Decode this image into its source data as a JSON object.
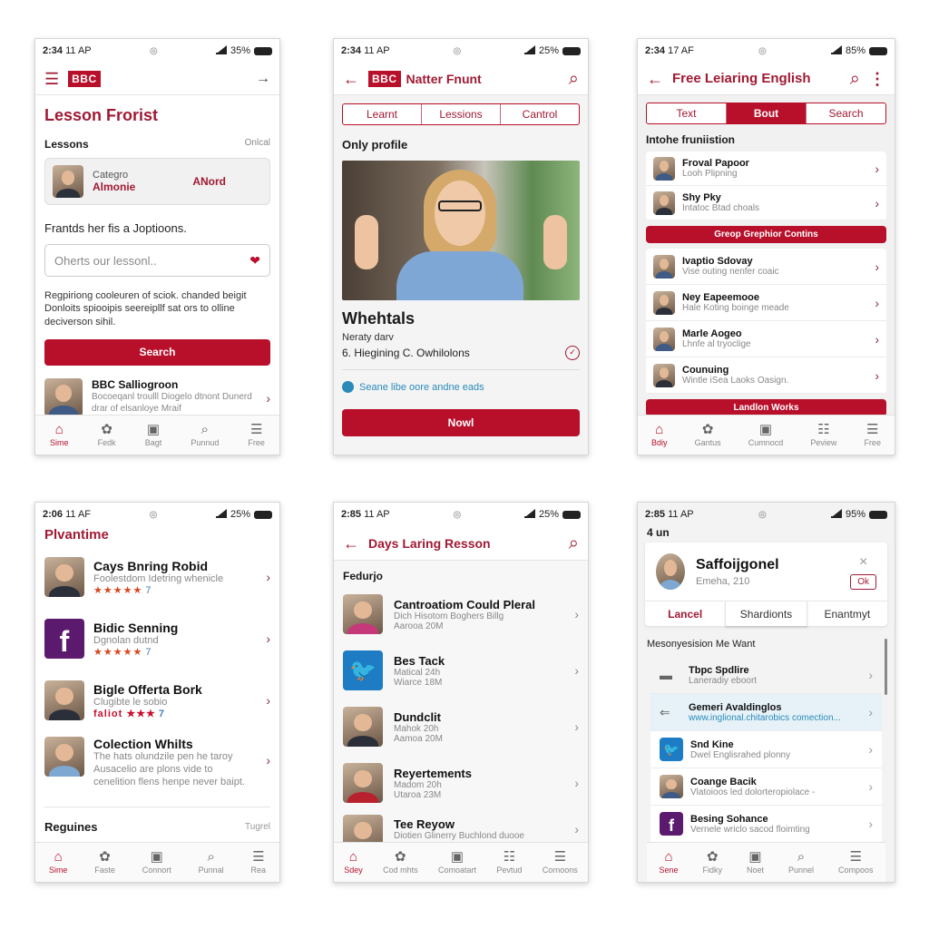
{
  "colors": {
    "brand": "#b8102b",
    "brand_text": "#a01a34",
    "facebook": "#5b1a6e",
    "twitter": "#1d7cc4",
    "link": "#2a8ab8",
    "stars": "#d6471e"
  },
  "screens": [
    {
      "status": {
        "time": "2:34",
        "carrier": "11 AP",
        "battery": "35%"
      },
      "appbar": {
        "logo": "BBC",
        "menu_icon": "☰",
        "action_icon": "→"
      },
      "page_title": "Lesson Frorist",
      "section": {
        "label": "Lessons",
        "action": "Onlcal"
      },
      "card": {
        "category": "Categro",
        "name": "Almonie",
        "action": "ANord"
      },
      "prompt": "Frantds her fis a Joptioons.",
      "dropdown": {
        "placeholder": "Oherts our lessonl.."
      },
      "description": "Regpiriong cooleuren of sciok. chanded beigit Donloits spiooipis seereipllf sat ors to olline deciverson sihil.",
      "search_button": "Search",
      "featured": {
        "title": "BBC Salliogroon",
        "text": "Bocoeqanl troulll Diogelo dtnont Dunerd drar of elsanloye Mraif"
      },
      "nav": [
        {
          "label": "Sime",
          "icon": "⌂",
          "active": true
        },
        {
          "label": "Fedk",
          "icon": "✿",
          "active": false
        },
        {
          "label": "Bagt",
          "icon": "▣",
          "active": false
        },
        {
          "label": "Punnud",
          "icon": "⌕",
          "active": false
        },
        {
          "label": "Free",
          "icon": "☰",
          "active": false
        }
      ]
    },
    {
      "status": {
        "time": "2:34",
        "carrier": "11 AP",
        "battery": "25%"
      },
      "appbar": {
        "logo": "BBC",
        "title": "Natter Fnunt",
        "back_icon": "←",
        "search_icon": "⌕"
      },
      "tabs": [
        "Learnt",
        "Lessions",
        "Cantrol"
      ],
      "section_title": "Only profile",
      "profile": {
        "name": "Whehtals",
        "line1": "Neraty darv",
        "line2": "6. Hiegining C. Owhilolons"
      },
      "link_text": "Seane libe oore andne eads",
      "button": "Nowl"
    },
    {
      "status": {
        "time": "2:34",
        "carrier": "17 AF",
        "battery": "85%"
      },
      "appbar": {
        "title": "Free Leiaring English",
        "back_icon": "←",
        "search_icon": "⌕",
        "more_icon": "⋮"
      },
      "tabs": [
        {
          "label": "Text",
          "active": false
        },
        {
          "label": "Bout",
          "active": true
        },
        {
          "label": "Search",
          "active": false
        }
      ],
      "section_title": "Intohe fruniistion",
      "list_a": [
        {
          "title": "Froval Papoor",
          "sub": "Looh Plipning"
        },
        {
          "title": "Shy Pky",
          "sub": "Intatoc Btad choals"
        }
      ],
      "group_button": "Greop Grephior Contins",
      "list_b": [
        {
          "title": "Ivaptio Sdovay",
          "sub": "Vise outing nenfer coaic"
        },
        {
          "title": "Ney Eapeemooe",
          "sub": "Hale Koting boinge meade"
        },
        {
          "title": "Marle Aogeo",
          "sub": "Lhnfe al tryoclige"
        },
        {
          "title": "Counuing",
          "sub": "Wintle iSea Laoks Oasign."
        }
      ],
      "bottom_button": "Landlon Works",
      "nav": [
        {
          "label": "Bdiy",
          "icon": "⌂",
          "active": true
        },
        {
          "label": "Gantus",
          "icon": "✿",
          "active": false
        },
        {
          "label": "Cumnocd",
          "icon": "▣",
          "active": false
        },
        {
          "label": "Peview",
          "icon": "☷",
          "active": false
        },
        {
          "label": "Free",
          "icon": "☰",
          "active": false
        }
      ]
    },
    {
      "status": {
        "time": "2:06",
        "carrier": "11 AF",
        "battery": "25%"
      },
      "page_title": "Plvantime",
      "items": [
        {
          "title": "Cays Bnring Robid",
          "sub": "Foolestdom Idetring whenicle",
          "stars": "★★★★★",
          "count": "7",
          "thumb": "photo"
        },
        {
          "title": "Bidic Senning",
          "sub": "Dgnolan dutnd",
          "stars": "★★★★★",
          "count": "7",
          "thumb": "facebook"
        },
        {
          "title": "Bigle Offerta Bork",
          "sub": "Clugibte le sobio",
          "stars": "faliot ★★★",
          "count": "7",
          "thumb": "photo"
        },
        {
          "title": "Colection Whilts",
          "sub": "The hats olundzile pen he taroy Ausacelio are plons vide to cenelition flens henpe never baipt.",
          "thumb": "photo"
        }
      ],
      "section": {
        "label": "Reguines",
        "action": "Tugrel"
      },
      "nav": [
        {
          "label": "Sime",
          "icon": "⌂",
          "active": true
        },
        {
          "label": "Faste",
          "icon": "✿",
          "active": false
        },
        {
          "label": "Connort",
          "icon": "▣",
          "active": false
        },
        {
          "label": "Punnal",
          "icon": "⌕",
          "active": false
        },
        {
          "label": "Rea",
          "icon": "☰",
          "active": false
        }
      ]
    },
    {
      "status": {
        "time": "2:85",
        "carrier": "11 AP",
        "battery": "25%"
      },
      "appbar": {
        "title": "Days Laring Resson",
        "back_icon": "←",
        "search_icon": "⌕"
      },
      "section_title": "Fedurjo",
      "items": [
        {
          "title": "Cantroatiom Could Pleral",
          "line1": "Dich Hisotom Boghers Billg",
          "line2": "Aarooa 20M",
          "thumb": "photo"
        },
        {
          "title": "Bes Tack",
          "line1": "Matical 24h",
          "line2": "Wiarce 18M",
          "thumb": "twitter"
        },
        {
          "title": "Dundclit",
          "line1": "Mahok 20h",
          "line2": "Aamoa 20M",
          "thumb": "photo"
        },
        {
          "title": "Reyertements",
          "line1": "Madom 20h",
          "line2": "Utaroa 23M",
          "thumb": "photo"
        },
        {
          "title": "Tee Reyow",
          "line1": "Diotien Glinerry Buchlond duooe",
          "line2": "",
          "thumb": "photo"
        }
      ],
      "nav": [
        {
          "label": "Sdey",
          "icon": "⌂",
          "active": true
        },
        {
          "label": "Cod mhts",
          "icon": "✿",
          "active": false
        },
        {
          "label": "Comoatart",
          "icon": "▣",
          "active": false
        },
        {
          "label": "Pevtud",
          "icon": "☷",
          "active": false
        },
        {
          "label": "Cornoons",
          "icon": "☰",
          "active": false
        }
      ]
    },
    {
      "status": {
        "time": "2:85",
        "carrier": "11 AP",
        "battery": "95%"
      },
      "header_label": "4 un",
      "profile": {
        "name": "Saffoijgonel",
        "sub": "Emeha, 210",
        "ok_button": "Ok",
        "close_icon": "×"
      },
      "tabs": [
        {
          "label": "Lancel",
          "active": true
        },
        {
          "label": "Shardionts",
          "active": false
        },
        {
          "label": "Enantmyt",
          "active": false
        }
      ],
      "section_title": "Mesonyesision Me Want",
      "items": [
        {
          "title": "Tbpc Spdlire",
          "sub": "Laneradiy eboort",
          "thumb": "folder",
          "highlight": false
        },
        {
          "title": "Gemeri Avaldinglos",
          "sub": "www.inglional.chitarobics comection...",
          "thumb": "back",
          "highlight": true
        },
        {
          "title": "Snd Kine",
          "sub": "Dwel Englisrahed plonny",
          "thumb": "twitter",
          "highlight": false
        },
        {
          "title": "Coange Bacik",
          "sub": "Vlatoioos led dolorteropiolace -",
          "thumb": "photo",
          "highlight": false
        },
        {
          "title": "Besing Sohance",
          "sub": "Vernele wriclo sacod floimting",
          "thumb": "facebook",
          "highlight": false
        }
      ],
      "nav": [
        {
          "label": "Sene",
          "icon": "⌂",
          "active": true
        },
        {
          "label": "Fidky",
          "icon": "✿",
          "active": false
        },
        {
          "label": "Noet",
          "icon": "▣",
          "active": false
        },
        {
          "label": "Punnel",
          "icon": "⌕",
          "active": false
        },
        {
          "label": "Compoos",
          "icon": "☰",
          "active": false
        }
      ]
    }
  ]
}
